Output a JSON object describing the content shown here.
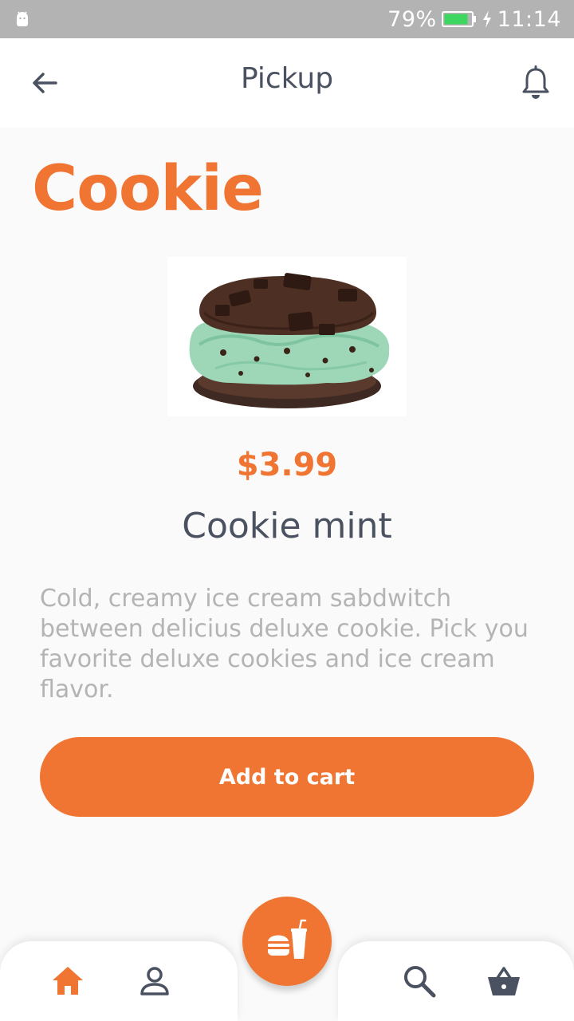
{
  "status_bar": {
    "battery": "79%",
    "time": "11:14",
    "icons": [
      "android-icon",
      "battery-icon",
      "charging-bolt-icon"
    ]
  },
  "header": {
    "title": "Pickup",
    "back_icon": "arrow-left-icon",
    "notification_icon": "bell-icon"
  },
  "category": "Cookie",
  "product": {
    "image": "ice-cream-cookie-sandwich",
    "price": "$3.99",
    "name": "Cookie mint",
    "description": "Cold, creamy ice cream sabdwitch between delicius deluxe cookie. Pick you favorite deluxe cookies and ice cream flavor."
  },
  "cta": {
    "label": "Add to cart"
  },
  "bottom_nav": {
    "items": [
      "home-icon",
      "profile-icon",
      "search-icon",
      "basket-icon"
    ],
    "fab_icon": "burger-drink-icon",
    "active": "home"
  },
  "colors": {
    "accent": "#f07432",
    "text_dark": "#4a5160",
    "text_muted": "#b4b4b4",
    "status_bar": "#b3b3b3",
    "background": "#fafafa"
  }
}
